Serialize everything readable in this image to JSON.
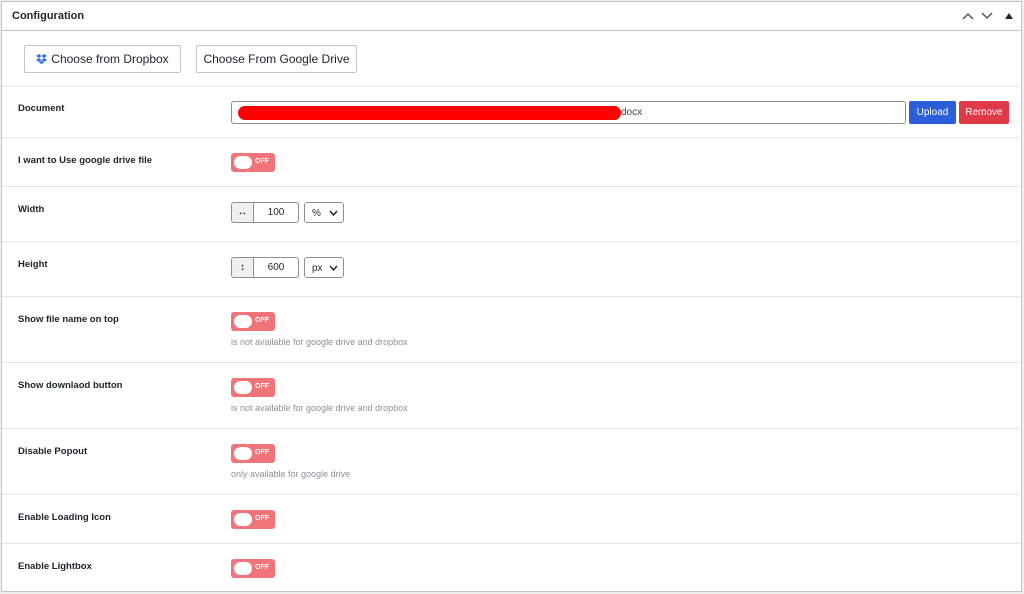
{
  "panel": {
    "title": "Configuration",
    "controls": [
      "chevron-up-icon",
      "chevron-down-icon",
      "triangle-up-icon"
    ]
  },
  "sources": {
    "dropbox_label": "Choose from Dropbox",
    "gdrive_label": "Choose From Google Drive"
  },
  "document": {
    "label": "Document",
    "value_suffix": "docx",
    "upload_label": "Upload",
    "remove_label": "Remove"
  },
  "use_gdrive": {
    "label": "I want to Use google drive file",
    "state": "OFF"
  },
  "width": {
    "label": "Width",
    "icon": "↔",
    "value": "100",
    "unit": "%"
  },
  "height": {
    "label": "Height",
    "icon": "↕",
    "value": "600",
    "unit": "px"
  },
  "show_file_name": {
    "label": "Show file name on top",
    "state": "OFF",
    "hint": "is not available for google drive and dropbox"
  },
  "show_download": {
    "label": "Show downlaod button",
    "state": "OFF",
    "hint": "is not available for google drive and dropbox"
  },
  "disable_popout": {
    "label": "Disable Popout",
    "state": "OFF",
    "hint": "only available for google drive"
  },
  "loading_icon": {
    "label": "Enable Loading Icon",
    "state": "OFF"
  },
  "lightbox": {
    "label": "Enable Lightbox",
    "state": "OFF"
  },
  "colors": {
    "toggle_off": "#f0747a",
    "upload": "#2b5fd9",
    "remove": "#e03a4a",
    "redaction": "#ff0000"
  }
}
